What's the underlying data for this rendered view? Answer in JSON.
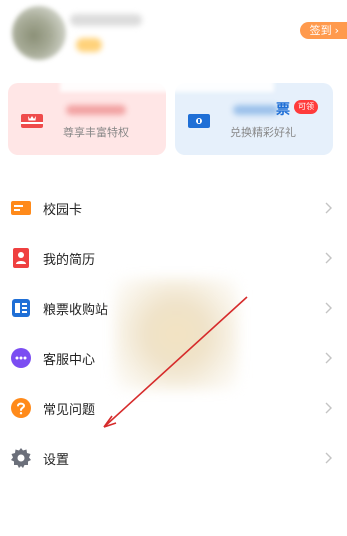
{
  "header": {
    "checkin_label": "签到",
    "checkin_chevron": "›"
  },
  "cards": {
    "vip": {
      "subtitle": "尊享丰富特权",
      "icon": "crown-card-icon"
    },
    "ticket": {
      "title_suffix": "票",
      "tag": "可领",
      "subtitle": "兑换精彩好礼",
      "icon": "ticket-card-icon"
    }
  },
  "menu": {
    "items": [
      {
        "label": "校园卡",
        "icon": "campus-card-icon"
      },
      {
        "label": "我的简历",
        "icon": "resume-icon"
      },
      {
        "label": "粮票收购站",
        "icon": "ticket-station-icon"
      },
      {
        "label": "客服中心",
        "icon": "customer-service-icon"
      },
      {
        "label": "常见问题",
        "icon": "help-icon"
      },
      {
        "label": "设置",
        "icon": "settings-gear-icon"
      }
    ]
  },
  "colors": {
    "accent_orange": "#ff9a4d",
    "vip_card_bg": "#ffe6e6",
    "ticket_card_bg": "#e6f0fb",
    "annotation_red": "#d62b2b"
  }
}
